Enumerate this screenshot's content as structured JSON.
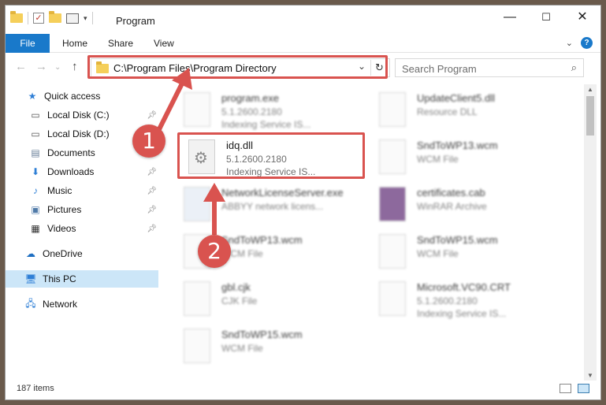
{
  "window": {
    "title": "Program",
    "controls": {
      "minimize": "—",
      "maximize": "☐",
      "close": "✕"
    }
  },
  "ribbon": {
    "tabs": [
      "File",
      "Home",
      "Share",
      "View"
    ],
    "expand_icon": "chevron-down-icon",
    "help": "?"
  },
  "address": {
    "path": "C:\\Program Files\\Program Directory",
    "search_placeholder": "Search Program"
  },
  "sidebar": {
    "items": [
      {
        "label": "Quick access",
        "icon": "star-icon",
        "pinned": false
      },
      {
        "label": "Local Disk (C:)",
        "icon": "drive-icon",
        "pinned": true
      },
      {
        "label": "Local Disk (D:)",
        "icon": "drive-icon",
        "pinned": true
      },
      {
        "label": "Documents",
        "icon": "documents-icon",
        "pinned": true
      },
      {
        "label": "Downloads",
        "icon": "download-icon",
        "pinned": true
      },
      {
        "label": "Music",
        "icon": "music-icon",
        "pinned": true
      },
      {
        "label": "Pictures",
        "icon": "pictures-icon",
        "pinned": true
      },
      {
        "label": "Videos",
        "icon": "videos-icon",
        "pinned": true
      },
      {
        "label": "OneDrive",
        "icon": "cloud-icon",
        "pinned": false
      },
      {
        "label": "This PC",
        "icon": "pc-icon",
        "pinned": false,
        "selected": true
      },
      {
        "label": "Network",
        "icon": "network-icon",
        "pinned": false
      }
    ]
  },
  "files": [
    {
      "name": "program.exe",
      "line2": "5.1.2600.2180",
      "line3": "Indexing Service IS..."
    },
    {
      "name": "UpdateClient5.dll",
      "line2": "Resource DLL",
      "line3": ""
    },
    {
      "name": "idq.dll",
      "line2": "5.1.2600.2180",
      "line3": "Indexing Service IS...",
      "highlighted": true
    },
    {
      "name": "SndToWP13.wcm",
      "line2": "WCM File",
      "line3": ""
    },
    {
      "name": "NetworkLicenseServer.exe",
      "line2": "ABBYY network licens...",
      "line3": ""
    },
    {
      "name": "certificates.cab",
      "line2": "WinRAR Archive",
      "line3": ""
    },
    {
      "name": "SndToWP13.wcm",
      "line2": "WCM File",
      "line3": ""
    },
    {
      "name": "SndToWP15.wcm",
      "line2": "WCM File",
      "line3": ""
    },
    {
      "name": "gbl.cjk",
      "line2": "CJK File",
      "line3": ""
    },
    {
      "name": "Microsoft.VC90.CRT",
      "line2": "5.1.2600.2180",
      "line3": "Indexing Service IS..."
    },
    {
      "name": "SndToWP15.wcm",
      "line2": "WCM File",
      "line3": ""
    }
  ],
  "status": {
    "items": "187 items"
  },
  "annotations": {
    "step1": "1",
    "step2": "2",
    "color": "#d9534f"
  }
}
